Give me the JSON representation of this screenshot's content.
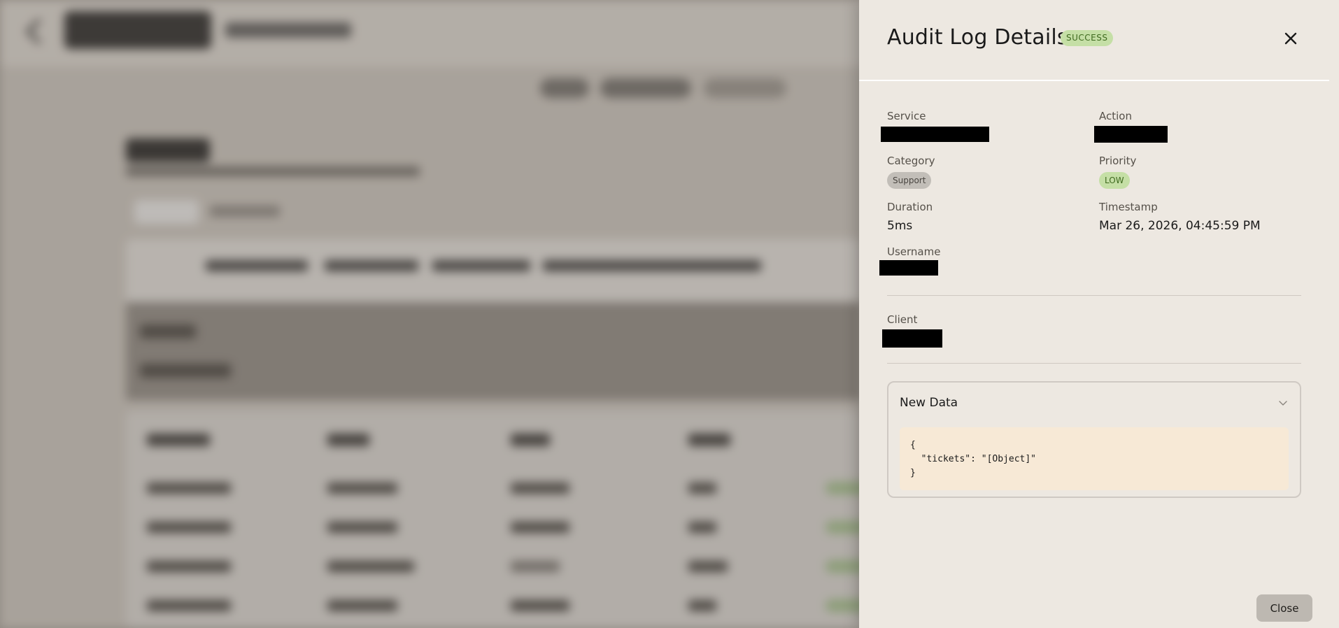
{
  "drawer": {
    "title": "Audit Log Details",
    "status_badge": "SUCCESS",
    "fields": {
      "service_label": "Service",
      "action_label": "Action",
      "category_label": "Category",
      "category_value": "Support",
      "priority_label": "Priority",
      "priority_value": "LOW",
      "duration_label": "Duration",
      "duration_value": "5ms",
      "timestamp_label": "Timestamp",
      "timestamp_value": "Mar 26, 2026, 04:45:59 PM",
      "username_label": "Username",
      "client_label": "Client"
    },
    "accordion": {
      "title": "New Data",
      "code": "{\n  \"tickets\": \"[Object]\"\n}"
    },
    "close_button_label": "Close",
    "icons": {
      "close": "close-icon",
      "expand": "chevron-down-icon"
    }
  },
  "colors": {
    "drawer_bg": "#ede8e1",
    "success_badge_bg": "#c5dfa6",
    "success_badge_text": "#3f6a1f",
    "code_bg": "#f7e9d6",
    "close_button_bg": "#bdb8b1"
  }
}
